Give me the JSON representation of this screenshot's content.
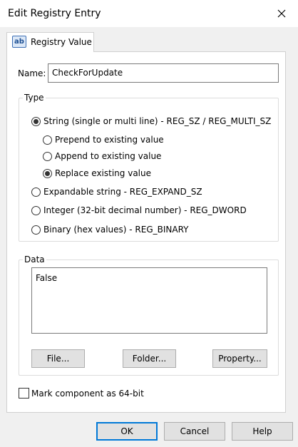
{
  "window": {
    "title": "Edit Registry Entry"
  },
  "tab": {
    "label": "Registry Value",
    "icon": "ab-registry-string-icon",
    "icon_text": "ab"
  },
  "name": {
    "label": "Name:",
    "value": "CheckForUpdate"
  },
  "type_group": {
    "label": "Type",
    "options": [
      {
        "label": "String (single or multi line) - REG_SZ / REG_MULTI_SZ",
        "checked": true
      },
      {
        "label": "Prepend to existing value",
        "checked": false
      },
      {
        "label": "Append to existing value",
        "checked": false
      },
      {
        "label": "Replace existing value",
        "checked": true
      },
      {
        "label": "Expandable string - REG_EXPAND_SZ",
        "checked": false
      },
      {
        "label": "Integer (32-bit decimal number) - REG_DWORD",
        "checked": false
      },
      {
        "label": "Binary (hex values) - REG_BINARY",
        "checked": false
      }
    ]
  },
  "data_group": {
    "label": "Data",
    "value": "False",
    "buttons": {
      "file": "File...",
      "folder": "Folder...",
      "property": "Property..."
    }
  },
  "mark64": {
    "label": "Mark component as 64-bit",
    "checked": false
  },
  "footer": {
    "ok": "OK",
    "cancel": "Cancel",
    "help": "Help"
  },
  "colors": {
    "accent": "#0078d7",
    "dialog_bg": "#f0f0f0",
    "panel_bg": "#ffffff"
  }
}
